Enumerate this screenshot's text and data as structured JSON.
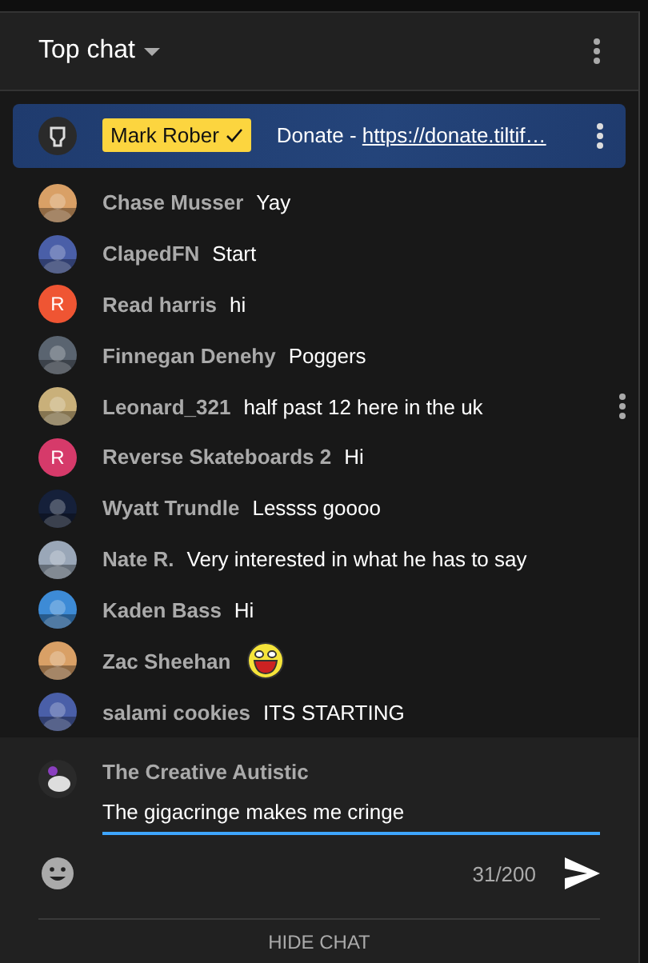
{
  "header": {
    "title": "Top chat"
  },
  "pinned": {
    "author": "Mark Rober",
    "verified": true,
    "message": "Donate - ",
    "link": "https://donate.tiltif…"
  },
  "messages": [
    {
      "author": "Chase Musser",
      "text": "Yay",
      "menu": false
    },
    {
      "author": "ClapedFN",
      "text": "Start",
      "menu": false
    },
    {
      "author": "Read harris",
      "text": "hi",
      "avatar": {
        "kind": "letter",
        "letter": "R",
        "color": "#ef5533"
      },
      "menu": false
    },
    {
      "author": "Finnegan Denehy",
      "text": "Poggers",
      "menu": false
    },
    {
      "author": "Leonard_321",
      "text": "half past 12 here in the uk",
      "menu": true
    },
    {
      "author": "Reverse Skateboards 2",
      "text": "Hi",
      "avatar": {
        "kind": "letter",
        "letter": "R",
        "color": "#d63a6a"
      },
      "menu": false
    },
    {
      "author": "Wyatt Trundle",
      "text": "Lessss goooo",
      "menu": false
    },
    {
      "author": "Nate R.",
      "text": "Very interested in what he has to say",
      "menu": false
    },
    {
      "author": "Kaden Bass",
      "text": "Hi",
      "menu": false
    },
    {
      "author": "Zac Sheehan",
      "emoji": true,
      "menu": false
    },
    {
      "author": "salami cookies",
      "text": "ITS STARTING",
      "menu": false
    }
  ],
  "composer": {
    "author": "The Creative Autistic",
    "value": "The gigacringe makes me cringe",
    "counter": "31/200"
  },
  "footer": {
    "label": "HIDE CHAT"
  }
}
